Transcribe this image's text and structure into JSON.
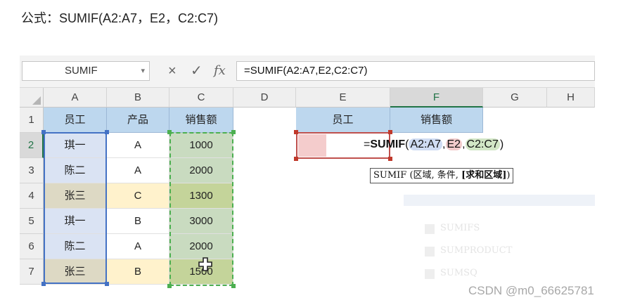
{
  "caption": "公式：SUMIF(A2:A7，E2，C2:C7)",
  "name_box": "SUMIF",
  "formula_bar": {
    "cancel_icon": "×",
    "enter_icon": "✓",
    "fx_label": "fx",
    "value": "=SUMIF(A2:A7,E2,C2:C7)"
  },
  "columns": [
    "A",
    "B",
    "C",
    "D",
    "E",
    "F",
    "G",
    "H"
  ],
  "rows": [
    "1",
    "2",
    "3",
    "4",
    "5",
    "6",
    "7"
  ],
  "table": {
    "headers": [
      "员工",
      "产品",
      "销售额"
    ],
    "data": [
      [
        "琪一",
        "A",
        "1000"
      ],
      [
        "陈二",
        "A",
        "2000"
      ],
      [
        "张三",
        "C",
        "1300"
      ],
      [
        "琪一",
        "B",
        "3000"
      ],
      [
        "陈二",
        "A",
        "2000"
      ],
      [
        "张三",
        "B",
        "1500"
      ]
    ]
  },
  "lookup": {
    "headers": [
      "员工",
      "销售额"
    ],
    "formula": {
      "prefix": "=",
      "func": "SUMIF",
      "open": "(",
      "arg1": "A2:A7",
      "comma1": ",",
      "arg2": "E2",
      "comma2": ",",
      "arg3": "C2:C7",
      "close": ")"
    }
  },
  "tooltip": {
    "text": "SUMIF (区域, 条件, ",
    "bold": "[求和区域]",
    "end": ")"
  },
  "ghost_menu": [
    "SUMIFS",
    "SUMPRODUCT",
    "SUMSQ"
  ],
  "colors": {
    "header_fill": "#bdd7ee",
    "range_a_border": "#4472c4",
    "range_c_border": "#4caf50",
    "criteria_border": "#c0504d",
    "excel_green": "#217346"
  },
  "watermark": "CSDN @m0_66625781"
}
